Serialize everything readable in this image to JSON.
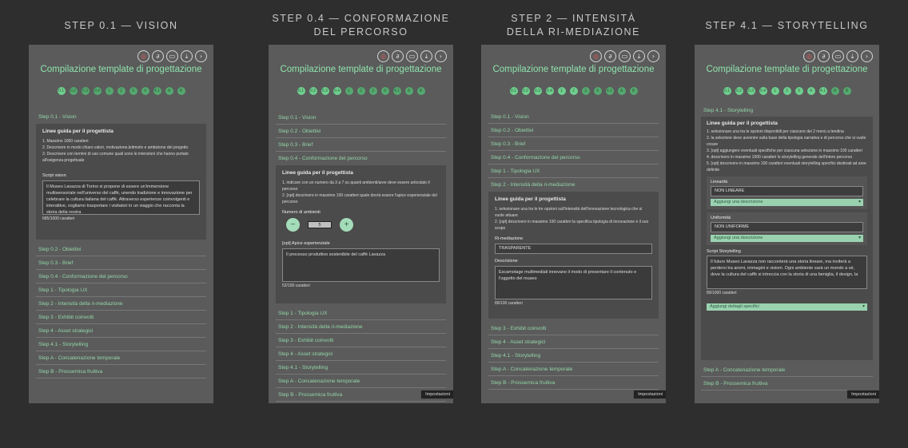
{
  "columns": [
    {
      "title": "STEP 0.1 — VISION"
    },
    {
      "title_line1": "STEP 0.4 — CONFORMAZIONE",
      "title_line2": "DEL PERCORSO"
    },
    {
      "title_line1": "STEP 2 — INTENSITÀ",
      "title_line2": "DELLA RI-MEDIAZIONE"
    },
    {
      "title": "STEP 4.1 — STORYTELLING"
    }
  ],
  "app": {
    "title": "Compilazione template di progettazione",
    "steps": [
      "0.1",
      "0.2",
      "0.3",
      "0.4",
      "1",
      "2",
      "3",
      "4",
      "4.1",
      "A",
      "B"
    ],
    "toolbar_icons": [
      "target-icon",
      "link-icon",
      "folder-icon",
      "download-icon",
      "next-icon"
    ],
    "settings_label": "Impostazioni"
  },
  "s1": {
    "open_item": "Step 0.1 - Vision",
    "guide_title": "Linee guida per il progettista",
    "guides": [
      "1. Massimo 1000 caratteri",
      "2. Descrivere in modo chiaro valori, motivazione,leitmotiv e ambizione del progetto",
      "3. Descrivere con termini di uso comune quali sono le intenzioni che hanno portato all'esigenza progettuale"
    ],
    "field_label": "Script vision",
    "field_text": "Il Museo Lavazza di Torino si propone di essere un'immersione multisensoriale nell'universo del caffè, unendo tradizione e innovazione per celebrare la cultura italiana del caffè. Attraverso esperienze coinvolgenti e interattive, vogliamo trasportare i visitatori in un viaggio che racconta la storia della nostra",
    "counter": "685/1000 caratteri",
    "items_after": [
      "Step 0.2 - Obiettivi",
      "Step 0.3 - Brief",
      "Step 0.4 - Conformazione del percorso",
      "Step 1 - Tipologia UX",
      "Step 2 - Intensità della ri-mediazione",
      "Step 3 - Exhibit coinvolti",
      "Step 4 - Asset strategici",
      "Step 4.1 - Storytelling",
      "Step A - Concatenazione temporale",
      "Step B - Prossemica fruitiva"
    ]
  },
  "s2": {
    "items_before": [
      "Step 0.1 - Vision",
      "Step 0.2 - Obiettivi",
      "Step 0.3 - Brief"
    ],
    "open_item": "Step 0.4 - Conformazione del percorso",
    "guide_title": "Linee guida per il progettista",
    "guides": [
      "1. indicare con un numero da 3 a 7 su quanti ambienti/aree deve essere articolato il percorso",
      "2. [opt] descrivere in massimo 100 caratteri quale dovrà essere l'apice esperienziale del percorso"
    ],
    "num_label": "Numero di ambienti",
    "num_value": "5",
    "field_label": "[opt] Apice esperienziale",
    "field_text": "Il processo produttivo sostenibile del caffè Lavazza",
    "counter": "52/100 caratteri",
    "items_after": [
      "Step 1 - Tipologia UX",
      "Step 2 - Intensità della ri-mediazione",
      "Step 3 - Exhibit coinvolti",
      "Step 4 - Asset strategici",
      "Step 4.1 - Storytelling",
      "Step A - Concatenazione temporale",
      "Step B - Prossemica fruitiva"
    ]
  },
  "s3": {
    "items_before": [
      "Step 0.1 - Vision",
      "Step 0.2 - Obiettivi",
      "Step 0.3 - Brief",
      "Step 0.4 - Conformazione del percorso",
      "Step 1 - Tipologia UX"
    ],
    "open_item": "Step 2 - Intensità della ri-mediazione",
    "guide_title": "Linee guida per il progettista",
    "guides": [
      "1. selezionare una tra le tre opzioni sull'intensità dell'innovazione tecnologica che si vuole attuare",
      "2. [opt] descrivere in massimo 100 caratteri la specifica tipologia di innovazione e il suo scopo"
    ],
    "select_label": "Ri-mediazione",
    "select_value": "TRASPARENTE",
    "field_label": "Descrizione",
    "field_text": "Escamotage multimediali innovano il modo di presentare il contenuto e l'oggetto del museo",
    "counter": "89/100 caratteri",
    "items_after": [
      "Step 3 - Exhibit coinvolti",
      "Step 4 - Asset strategici",
      "Step 4.1 - Storytelling",
      "Step A - Concatenazione temporale",
      "Step B - Prossemica fruitiva"
    ]
  },
  "s4": {
    "open_item": "Step 4.1 - Storytelling",
    "guide_title": "Linee guida per il progettista",
    "guides": [
      "1. selezionare una tra le opzioni disponibili per ciascuno dei 2 menù a tendina",
      "2. la selezione deve avvenire sulla base della tipologia narrativa e di percorso che si vuole creare",
      "3. [opt] aggiungere eventuali specifiche per ciascuna selezione in massimo 100 caratteri",
      "4. descrivere in massimo 1000 caratteri lo storytelling generale dell'intero percorso",
      "5. [opt] descrivere in massimo 100 caratteri eventuali storytelling specifici destinati ad aree definite"
    ],
    "lin_label": "Linearità",
    "lin_value": "NON LINEARE",
    "uni_label": "Uniformità",
    "uni_value": "NON UNIFORME",
    "add_desc": "Aggiungi una descrizione",
    "field_label": "Script Storytelling",
    "field_text": "Il futuro Museo Lavazza non racconterà una storia lineare, ma inviterà a perdersi tra aromi, immagini e visioni. Ogni ambiente sarà un mondo a sé, dove la cultura del caffè si intreccia con la storia di una famiglia, il design, la",
    "counter": "89/1000 caratteri",
    "add_details": "Aggiungi dettagli specifici",
    "items_after": [
      "Step A - Concatenazione temporale",
      "Step B - Prossemica fruitiva"
    ]
  }
}
